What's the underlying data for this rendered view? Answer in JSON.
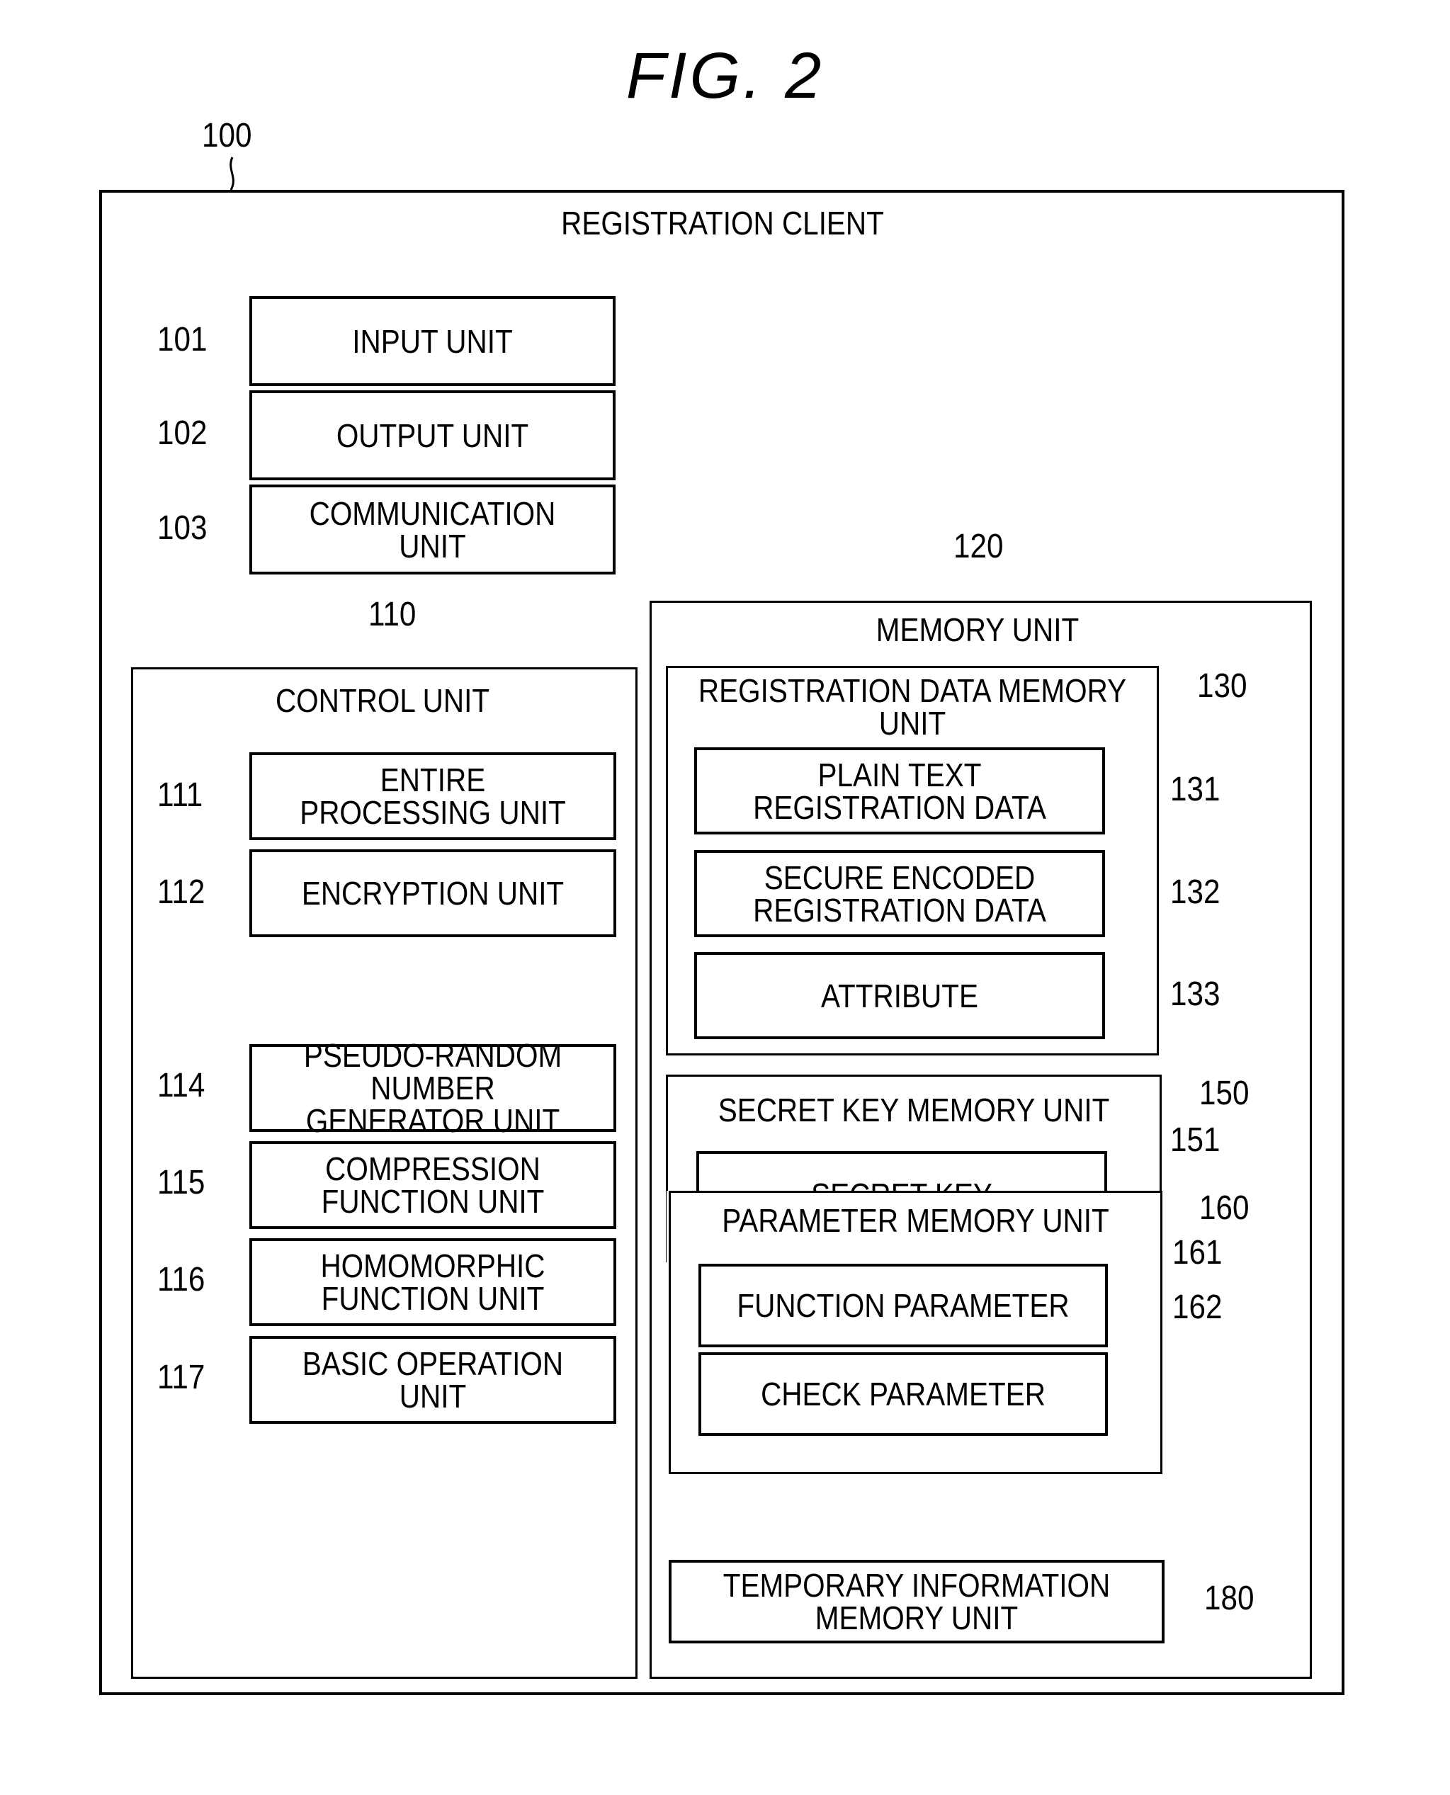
{
  "figure": {
    "title": "FIG.  2"
  },
  "client": {
    "ref": "100",
    "title": "REGISTRATION CLIENT"
  },
  "io_units": [
    {
      "ref": "101",
      "label": "INPUT UNIT"
    },
    {
      "ref": "102",
      "label": "OUTPUT UNIT"
    },
    {
      "ref": "103",
      "label": "COMMUNICATION UNIT"
    }
  ],
  "control_unit": {
    "ref": "110",
    "title": "CONTROL UNIT",
    "items": [
      {
        "ref": "111",
        "label": "ENTIRE\nPROCESSING UNIT"
      },
      {
        "ref": "112",
        "label": "ENCRYPTION UNIT"
      },
      {
        "ref": "114",
        "label": "PSEUDO-RANDOM NUMBER\nGENERATOR UNIT"
      },
      {
        "ref": "115",
        "label": "COMPRESSION\nFUNCTION UNIT"
      },
      {
        "ref": "116",
        "label": "HOMOMORPHIC\nFUNCTION UNIT"
      },
      {
        "ref": "117",
        "label": "BASIC OPERATION\nUNIT"
      }
    ]
  },
  "memory_unit": {
    "ref": "120",
    "title": "MEMORY UNIT",
    "registration_data": {
      "ref": "130",
      "title": "REGISTRATION DATA MEMORY\nUNIT",
      "items": [
        {
          "ref": "131",
          "label": "PLAIN TEXT\nREGISTRATION DATA"
        },
        {
          "ref": "132",
          "label": "SECURE ENCODED\nREGISTRATION DATA"
        },
        {
          "ref": "133",
          "label": "ATTRIBUTE"
        }
      ]
    },
    "secret_key": {
      "ref": "150",
      "title": "SECRET KEY MEMORY UNIT",
      "items": [
        {
          "ref": "151",
          "label": "SECRET KEY"
        }
      ]
    },
    "parameter": {
      "ref": "160",
      "title": "PARAMETER MEMORY UNIT",
      "items": [
        {
          "ref": "161",
          "label": "FUNCTION PARAMETER"
        },
        {
          "ref": "162",
          "label": "CHECK PARAMETER"
        }
      ]
    },
    "temporary": {
      "ref": "180",
      "label": "TEMPORARY INFORMATION\nMEMORY UNIT"
    }
  }
}
